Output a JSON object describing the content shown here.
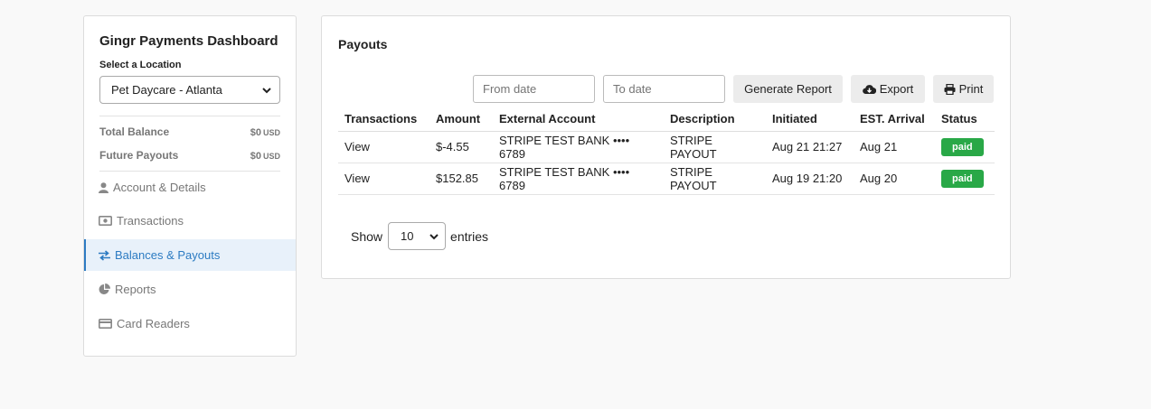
{
  "sidebar": {
    "title": "Gingr Payments Dashboard",
    "location_label": "Select a Location",
    "location_value": "Pet Daycare - Atlanta",
    "balances": [
      {
        "label": "Total Balance",
        "amount": "$0",
        "currency": "USD"
      },
      {
        "label": "Future Payouts",
        "amount": "$0",
        "currency": "USD"
      }
    ],
    "nav": [
      {
        "label": "Account & Details",
        "icon": "user-icon"
      },
      {
        "label": "Transactions",
        "icon": "money-icon"
      },
      {
        "label": "Balances & Payouts",
        "icon": "exchange-icon",
        "active": true
      },
      {
        "label": "Reports",
        "icon": "pie-chart-icon"
      },
      {
        "label": "Card Readers",
        "icon": "credit-card-icon"
      }
    ]
  },
  "payouts": {
    "title": "Payouts",
    "from_placeholder": "From date",
    "to_placeholder": "To date",
    "generate_label": "Generate Report",
    "export_label": "Export",
    "print_label": "Print",
    "columns": [
      "Transactions",
      "Amount",
      "External Account",
      "Description",
      "Initiated",
      "EST. Arrival",
      "Status"
    ],
    "rows": [
      {
        "transactions": "View",
        "amount": "$-4.55",
        "account": "STRIPE TEST BANK •••• 6789",
        "description": "STRIPE PAYOUT",
        "initiated": "Aug 21 21:27",
        "arrival": "Aug 21",
        "status": "paid"
      },
      {
        "transactions": "View",
        "amount": "$152.85",
        "account": "STRIPE TEST BANK •••• 6789",
        "description": "STRIPE PAYOUT",
        "initiated": "Aug 19 21:20",
        "arrival": "Aug 20",
        "status": "paid"
      }
    ],
    "show_label": "Show",
    "page_length": "10",
    "entries_label": "entries"
  },
  "colors": {
    "accent": "#2c7bc2",
    "paid": "#29a847"
  }
}
